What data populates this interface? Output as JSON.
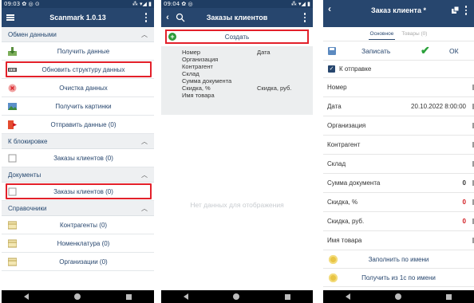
{
  "screen1": {
    "status": {
      "time": "09:03",
      "icons": "✿ ◎ ⊙",
      "right": "⁂ ▾◢ ▮"
    },
    "title": "Scanmark 1.0.13",
    "sections": [
      {
        "title": "Обмен данными",
        "items": [
          "Получить данные",
          "Обновить структуру данных",
          "Очистка данных",
          "Получить картинки",
          "Отправить данные (0)"
        ]
      },
      {
        "title": "К блокировке",
        "items": [
          "Заказы клиентов (0)"
        ]
      },
      {
        "title": "Документы",
        "items": [
          "Заказы клиентов (0)"
        ]
      },
      {
        "title": "Справочники",
        "items": [
          "Контрагенты (0)",
          "Номенклатура (0)",
          "Организации (0)"
        ]
      }
    ]
  },
  "screen2": {
    "status": {
      "time": "09:04",
      "icons": "✿ ◎",
      "right": "⁂ ▾◢ ▮"
    },
    "title": "Заказы клиентов",
    "create_label": "Создать",
    "fields_left": [
      "Номер",
      "Организация",
      "Контрагент",
      "Склад",
      "Сумма документа",
      "Скидка, %",
      "Имя товара"
    ],
    "fields_right": [
      "Дата",
      "Скидка, руб."
    ],
    "empty_text": "Нет данных для отображения"
  },
  "screen3": {
    "title": "Заказ клиента",
    "title_mark": "*",
    "tabs": {
      "main": "Основное",
      "goods": "Товары (0)"
    },
    "save_label": "Записать",
    "ok_label": "ОК",
    "checkbox_label": "К отправке",
    "fields": [
      {
        "label": "Номер",
        "value": ""
      },
      {
        "label": "Дата",
        "value": "20.10.2022 8:00:00"
      },
      {
        "label": "Организация",
        "value": ""
      },
      {
        "label": "Контрагент",
        "value": ""
      },
      {
        "label": "Склад",
        "value": ""
      },
      {
        "label": "Сумма документа",
        "value": "0"
      },
      {
        "label": "Скидка, %",
        "value": "0"
      },
      {
        "label": "Скидка, руб.",
        "value": "0"
      },
      {
        "label": "Имя товара",
        "value": ""
      }
    ],
    "buttons": [
      "Заполнить по имени",
      "Получить из 1с по имени"
    ]
  },
  "colors": {
    "header": "#27466e",
    "statusbar": "#1f3d63",
    "highlight": "#e3202a",
    "accent_green": "#2aa13a",
    "value_red": "#d0161c"
  }
}
